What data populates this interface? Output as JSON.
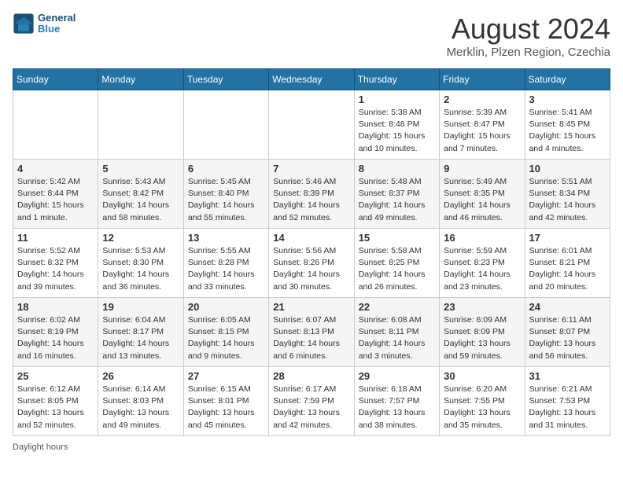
{
  "header": {
    "logo_line1": "General",
    "logo_line2": "Blue",
    "month_year": "August 2024",
    "location": "Merklin, Plzen Region, Czechia"
  },
  "days_of_week": [
    "Sunday",
    "Monday",
    "Tuesday",
    "Wednesday",
    "Thursday",
    "Friday",
    "Saturday"
  ],
  "weeks": [
    [
      {
        "day": "",
        "sunrise": "",
        "sunset": "",
        "daylight": ""
      },
      {
        "day": "",
        "sunrise": "",
        "sunset": "",
        "daylight": ""
      },
      {
        "day": "",
        "sunrise": "",
        "sunset": "",
        "daylight": ""
      },
      {
        "day": "",
        "sunrise": "",
        "sunset": "",
        "daylight": ""
      },
      {
        "day": "1",
        "sunrise": "Sunrise: 5:38 AM",
        "sunset": "Sunset: 8:48 PM",
        "daylight": "Daylight: 15 hours and 10 minutes."
      },
      {
        "day": "2",
        "sunrise": "Sunrise: 5:39 AM",
        "sunset": "Sunset: 8:47 PM",
        "daylight": "Daylight: 15 hours and 7 minutes."
      },
      {
        "day": "3",
        "sunrise": "Sunrise: 5:41 AM",
        "sunset": "Sunset: 8:45 PM",
        "daylight": "Daylight: 15 hours and 4 minutes."
      }
    ],
    [
      {
        "day": "4",
        "sunrise": "Sunrise: 5:42 AM",
        "sunset": "Sunset: 8:44 PM",
        "daylight": "Daylight: 15 hours and 1 minute."
      },
      {
        "day": "5",
        "sunrise": "Sunrise: 5:43 AM",
        "sunset": "Sunset: 8:42 PM",
        "daylight": "Daylight: 14 hours and 58 minutes."
      },
      {
        "day": "6",
        "sunrise": "Sunrise: 5:45 AM",
        "sunset": "Sunset: 8:40 PM",
        "daylight": "Daylight: 14 hours and 55 minutes."
      },
      {
        "day": "7",
        "sunrise": "Sunrise: 5:46 AM",
        "sunset": "Sunset: 8:39 PM",
        "daylight": "Daylight: 14 hours and 52 minutes."
      },
      {
        "day": "8",
        "sunrise": "Sunrise: 5:48 AM",
        "sunset": "Sunset: 8:37 PM",
        "daylight": "Daylight: 14 hours and 49 minutes."
      },
      {
        "day": "9",
        "sunrise": "Sunrise: 5:49 AM",
        "sunset": "Sunset: 8:35 PM",
        "daylight": "Daylight: 14 hours and 46 minutes."
      },
      {
        "day": "10",
        "sunrise": "Sunrise: 5:51 AM",
        "sunset": "Sunset: 8:34 PM",
        "daylight": "Daylight: 14 hours and 42 minutes."
      }
    ],
    [
      {
        "day": "11",
        "sunrise": "Sunrise: 5:52 AM",
        "sunset": "Sunset: 8:32 PM",
        "daylight": "Daylight: 14 hours and 39 minutes."
      },
      {
        "day": "12",
        "sunrise": "Sunrise: 5:53 AM",
        "sunset": "Sunset: 8:30 PM",
        "daylight": "Daylight: 14 hours and 36 minutes."
      },
      {
        "day": "13",
        "sunrise": "Sunrise: 5:55 AM",
        "sunset": "Sunset: 8:28 PM",
        "daylight": "Daylight: 14 hours and 33 minutes."
      },
      {
        "day": "14",
        "sunrise": "Sunrise: 5:56 AM",
        "sunset": "Sunset: 8:26 PM",
        "daylight": "Daylight: 14 hours and 30 minutes."
      },
      {
        "day": "15",
        "sunrise": "Sunrise: 5:58 AM",
        "sunset": "Sunset: 8:25 PM",
        "daylight": "Daylight: 14 hours and 26 minutes."
      },
      {
        "day": "16",
        "sunrise": "Sunrise: 5:59 AM",
        "sunset": "Sunset: 8:23 PM",
        "daylight": "Daylight: 14 hours and 23 minutes."
      },
      {
        "day": "17",
        "sunrise": "Sunrise: 6:01 AM",
        "sunset": "Sunset: 8:21 PM",
        "daylight": "Daylight: 14 hours and 20 minutes."
      }
    ],
    [
      {
        "day": "18",
        "sunrise": "Sunrise: 6:02 AM",
        "sunset": "Sunset: 8:19 PM",
        "daylight": "Daylight: 14 hours and 16 minutes."
      },
      {
        "day": "19",
        "sunrise": "Sunrise: 6:04 AM",
        "sunset": "Sunset: 8:17 PM",
        "daylight": "Daylight: 14 hours and 13 minutes."
      },
      {
        "day": "20",
        "sunrise": "Sunrise: 6:05 AM",
        "sunset": "Sunset: 8:15 PM",
        "daylight": "Daylight: 14 hours and 9 minutes."
      },
      {
        "day": "21",
        "sunrise": "Sunrise: 6:07 AM",
        "sunset": "Sunset: 8:13 PM",
        "daylight": "Daylight: 14 hours and 6 minutes."
      },
      {
        "day": "22",
        "sunrise": "Sunrise: 6:08 AM",
        "sunset": "Sunset: 8:11 PM",
        "daylight": "Daylight: 14 hours and 3 minutes."
      },
      {
        "day": "23",
        "sunrise": "Sunrise: 6:09 AM",
        "sunset": "Sunset: 8:09 PM",
        "daylight": "Daylight: 13 hours and 59 minutes."
      },
      {
        "day": "24",
        "sunrise": "Sunrise: 6:11 AM",
        "sunset": "Sunset: 8:07 PM",
        "daylight": "Daylight: 13 hours and 56 minutes."
      }
    ],
    [
      {
        "day": "25",
        "sunrise": "Sunrise: 6:12 AM",
        "sunset": "Sunset: 8:05 PM",
        "daylight": "Daylight: 13 hours and 52 minutes."
      },
      {
        "day": "26",
        "sunrise": "Sunrise: 6:14 AM",
        "sunset": "Sunset: 8:03 PM",
        "daylight": "Daylight: 13 hours and 49 minutes."
      },
      {
        "day": "27",
        "sunrise": "Sunrise: 6:15 AM",
        "sunset": "Sunset: 8:01 PM",
        "daylight": "Daylight: 13 hours and 45 minutes."
      },
      {
        "day": "28",
        "sunrise": "Sunrise: 6:17 AM",
        "sunset": "Sunset: 7:59 PM",
        "daylight": "Daylight: 13 hours and 42 minutes."
      },
      {
        "day": "29",
        "sunrise": "Sunrise: 6:18 AM",
        "sunset": "Sunset: 7:57 PM",
        "daylight": "Daylight: 13 hours and 38 minutes."
      },
      {
        "day": "30",
        "sunrise": "Sunrise: 6:20 AM",
        "sunset": "Sunset: 7:55 PM",
        "daylight": "Daylight: 13 hours and 35 minutes."
      },
      {
        "day": "31",
        "sunrise": "Sunrise: 6:21 AM",
        "sunset": "Sunset: 7:53 PM",
        "daylight": "Daylight: 13 hours and 31 minutes."
      }
    ]
  ],
  "footer": {
    "daylight_note": "Daylight hours"
  }
}
